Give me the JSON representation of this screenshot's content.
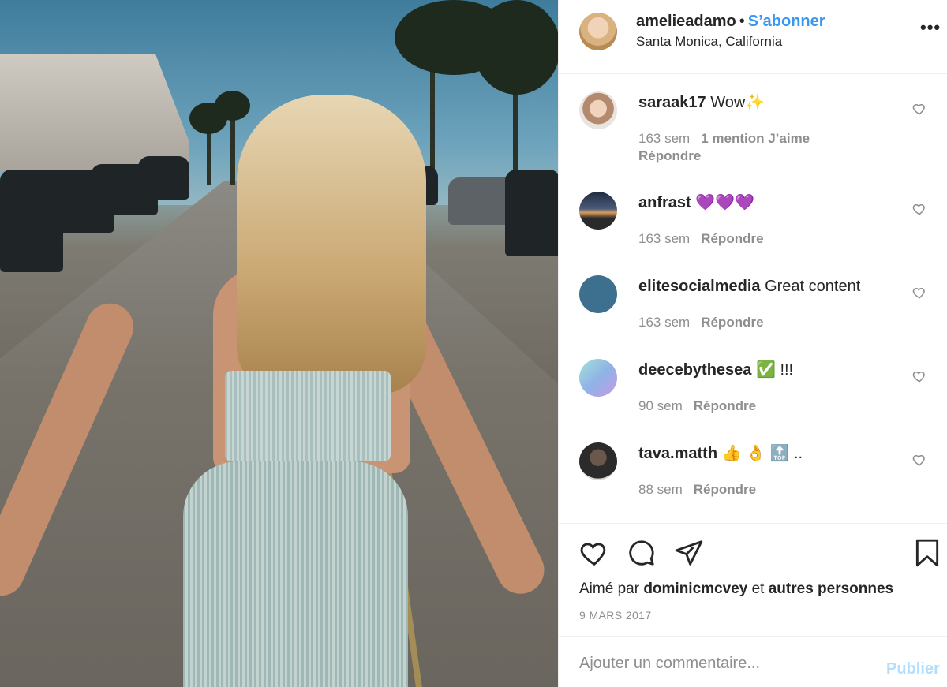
{
  "post": {
    "photo_icon": "street-photo",
    "header": {
      "username": "amelieadamo",
      "separator": "•",
      "follow_label": "S’abonner",
      "location": "Santa Monica, California",
      "more_icon": "more-horizontal-icon",
      "more_label": "•••"
    },
    "comments": [
      {
        "user": "saraak17",
        "text": "Wow✨",
        "time": "163 sem",
        "likes": "1 mention J’aime",
        "reply": "Répondre"
      },
      {
        "user": "anfrast",
        "text": "💜💜💜",
        "time": "163 sem",
        "reply": "Répondre"
      },
      {
        "user": "elitesocialmedia",
        "text": "Great content",
        "time": "163 sem",
        "reply": "Répondre"
      },
      {
        "user": "deecebythesea",
        "text": "✅ !!!",
        "time": "90 sem",
        "reply": "Répondre"
      },
      {
        "user": "tava.matth",
        "text": "👍 👌 🔝 ..",
        "time": "88 sem",
        "reply": "Répondre"
      }
    ],
    "actions": {
      "icons": [
        "heart-icon",
        "comment-icon",
        "share-icon",
        "bookmark-icon"
      ],
      "liked_prefix": "Aimé par",
      "liked_user": "dominicmcvey",
      "liked_and": "et",
      "liked_others": "autres personnes",
      "date": "9 MARS 2017"
    },
    "add_comment": {
      "placeholder": "Ajouter un commentaire...",
      "publish_label": "Publier"
    }
  }
}
